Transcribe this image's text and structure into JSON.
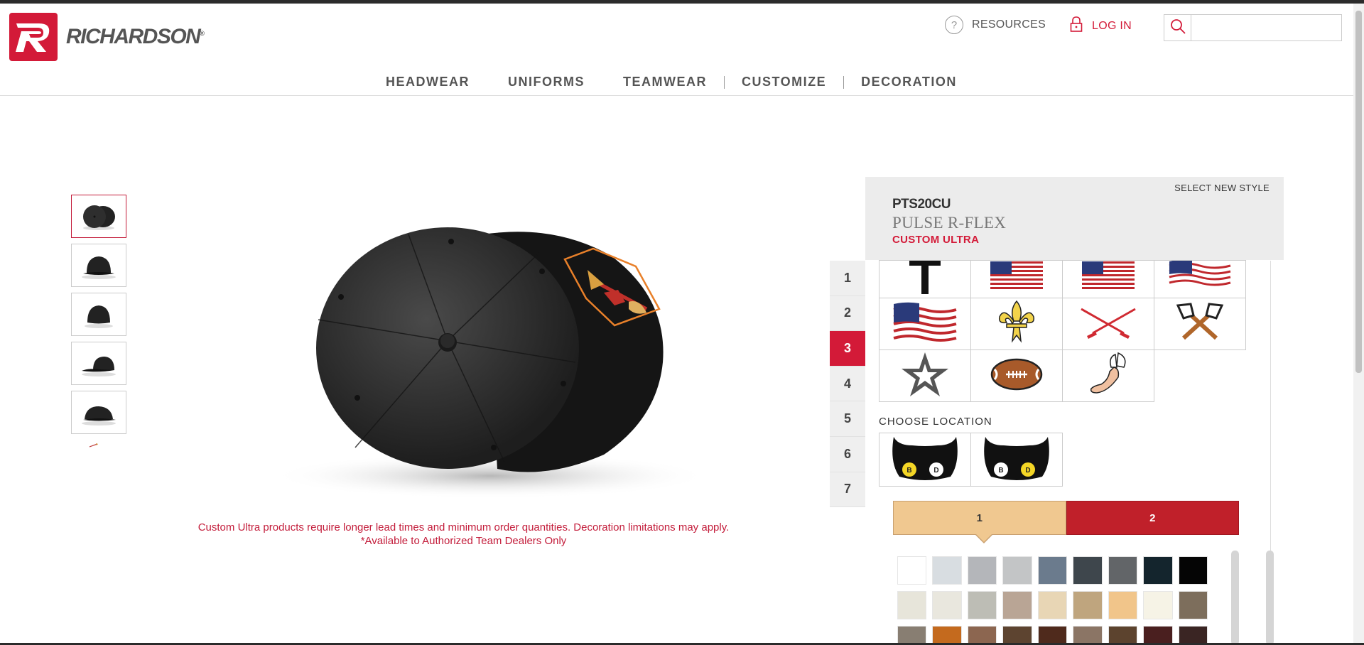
{
  "header": {
    "brand": "RICHARDSON",
    "brand_mark": "®",
    "resources_label": "RESOURCES",
    "login_label": "LOG IN",
    "search_placeholder": ""
  },
  "nav": {
    "items": [
      "HEADWEAR",
      "UNIFORMS",
      "TEAMWEAR",
      "CUSTOMIZE",
      "DECORATION"
    ]
  },
  "product": {
    "select_new_style": "SELECT NEW STYLE",
    "code": "PTS20CU",
    "name": "PULSE R-FLEX",
    "tag": "CUSTOM ULTRA",
    "disclaimer_line1": "Custom Ultra products require longer lead times and minimum order quantities. Decoration limitations may apply.",
    "disclaimer_line2": "*Available to Authorized Team Dealers Only"
  },
  "steps": [
    "1",
    "2",
    "3",
    "4",
    "5",
    "6",
    "7"
  ],
  "active_step": "3",
  "logos": [
    [
      "letter-t-icon",
      "us-flag-icon",
      "us-flag-icon",
      "waving-flag-icon"
    ],
    [
      "waving-flag-icon",
      "fleur-de-lis-icon",
      "golf-clubs-icon",
      "crossed-axes-icon"
    ],
    [
      "star-icon",
      "football-icon",
      "winged-foot-icon"
    ]
  ],
  "location": {
    "label": "CHOOSE LOCATION",
    "options": [
      {
        "left": "B",
        "right": "D",
        "selected": "left"
      },
      {
        "left": "B",
        "right": "D",
        "selected": "right"
      }
    ]
  },
  "color_tabs": [
    {
      "label": "1",
      "color": "#f0c890"
    },
    {
      "label": "2",
      "color": "#c0202a"
    }
  ],
  "swatches": [
    [
      "#ffffff",
      "#d8dde1",
      "#b4b6ba",
      "#c3c5c6",
      "#6b7b8d",
      "#3e464c",
      "#626568",
      "#14252d",
      "#050505"
    ],
    [
      "#e7e5da",
      "#e9e7de",
      "#bdbdb5",
      "#b9a595",
      "#e8d6b5",
      "#bfa57e",
      "#f1c58a",
      "#f6f3e6",
      "#7d6e5c"
    ],
    [
      "#887e72",
      "#c46a1e",
      "#8c6650",
      "#5d4430",
      "#4f2a1c",
      "#8b7565",
      "#5c432e",
      "#4a1f1f",
      "#3a2523"
    ]
  ],
  "colors": {
    "brand_red": "#d31a38",
    "panel_gray": "#ececec"
  }
}
